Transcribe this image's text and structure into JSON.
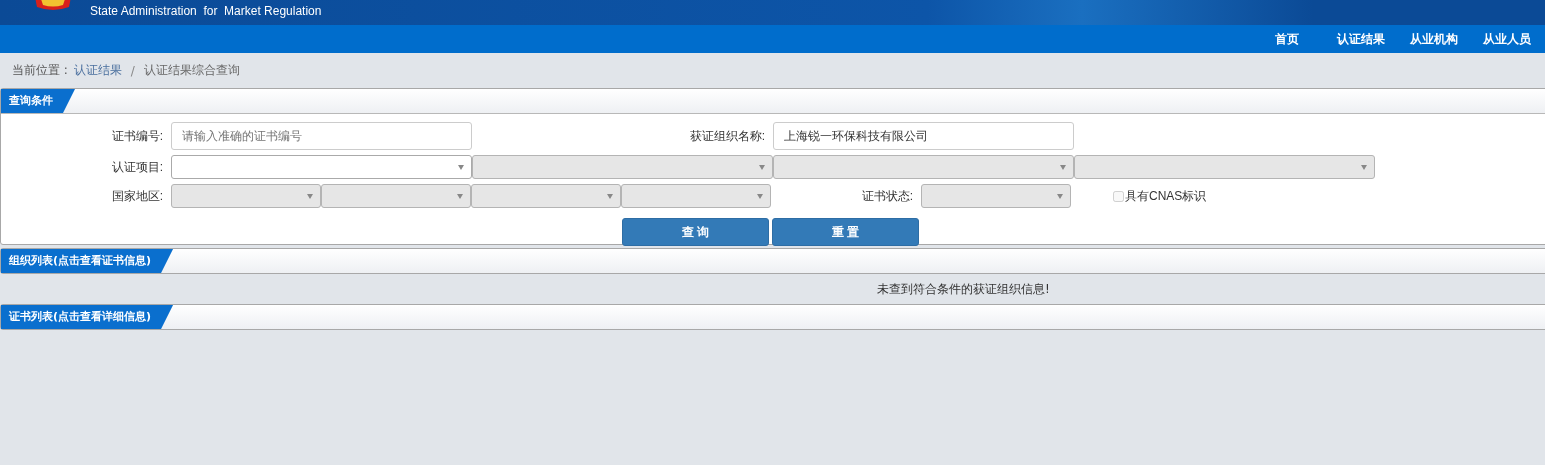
{
  "header": {
    "subtitle": "State Administration  for  Market Regulation"
  },
  "nav": [
    {
      "label": "首页"
    },
    {
      "label": "认证结果"
    },
    {
      "label": "从业机构"
    },
    {
      "label": "从业人员"
    }
  ],
  "breadcrumb": {
    "prefix": "当前位置 :",
    "separator": "/",
    "items": [
      {
        "label": "认证结果",
        "link": true
      },
      {
        "label": "认证结果综合查询",
        "link": false
      }
    ]
  },
  "query_panel": {
    "title": "查询条件",
    "cert_number": {
      "label": "证书编号:",
      "placeholder": "请输入准确的证书编号"
    },
    "org_name": {
      "label": "获证组织名称:",
      "value": "上海锐一环保科技有限公司"
    },
    "cert_project": {
      "label": "认证项目:",
      "selects": [
        {
          "disabled": false
        },
        {
          "disabled": true
        },
        {
          "disabled": true
        },
        {
          "disabled": true
        }
      ]
    },
    "region": {
      "label": "国家地区:",
      "selects": [
        {
          "disabled": true
        },
        {
          "disabled": true
        },
        {
          "disabled": true
        },
        {
          "disabled": true
        }
      ]
    },
    "cert_status": {
      "label": "证书状态:",
      "disabled": true
    },
    "cnas": {
      "label": "具有CNAS标识",
      "checked": false,
      "disabled": true
    },
    "buttons": [
      {
        "label": "查 询"
      },
      {
        "label": "重 置"
      }
    ]
  },
  "org_panel": {
    "title": "组织列表(点击查看证书信息)",
    "message": "未查到符合条件的获证组织信息!"
  },
  "cert_panel": {
    "title": "证书列表(点击查看详细信息)"
  }
}
